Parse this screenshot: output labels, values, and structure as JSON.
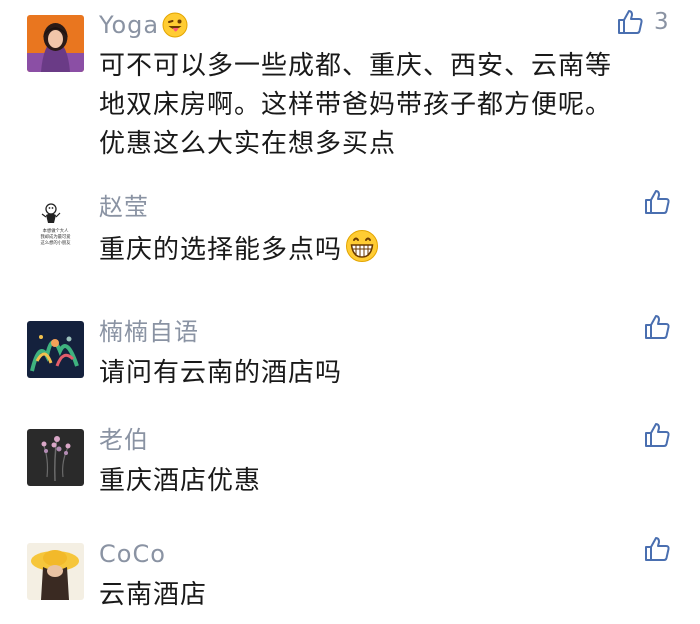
{
  "colors": {
    "name": "#8a93a3",
    "text": "#191919",
    "icon": "#4a6fb0"
  },
  "comments": [
    {
      "name": "Yoga",
      "name_emoji": "winking-tongue-emoji",
      "text_lines": [
        "可不可以多一些成都、重庆、西安、云南等",
        "地双床房啊。这样带爸妈带孩子都方便呢。",
        "优惠这么大实在想多买点"
      ],
      "likes": "3"
    },
    {
      "name": "赵莹",
      "text": "重庆的选择能多点吗",
      "text_emoji": "grinning-face-emoji",
      "avatar_text_lines": [
        "本想做个大人",
        "我却成为最可爱",
        "这么想的小朋友"
      ]
    },
    {
      "name": "楠楠自语",
      "text": "请问有云南的酒店吗"
    },
    {
      "name": "老伯",
      "text": "重庆酒店优惠"
    },
    {
      "name": "CoCo",
      "text": "云南酒店"
    }
  ]
}
